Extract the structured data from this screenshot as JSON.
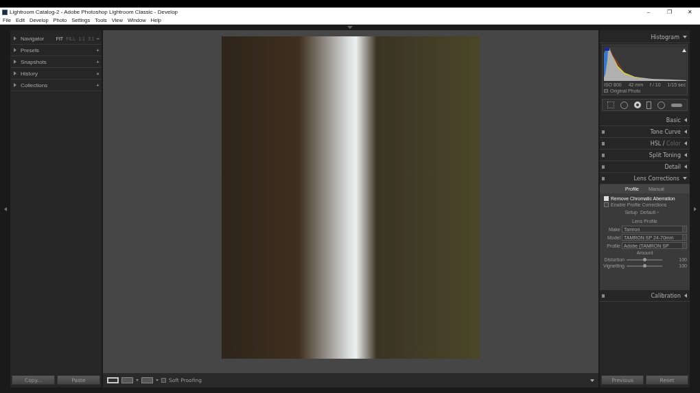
{
  "window": {
    "title": "Lightroom Catalog-2 - Adobe Photoshop Lightroom Classic - Develop",
    "controls": [
      "–",
      "❐",
      "✕"
    ]
  },
  "menu": [
    "File",
    "Edit",
    "Develop",
    "Photo",
    "Settings",
    "Tools",
    "View",
    "Window",
    "Help"
  ],
  "left_panels": [
    {
      "label": "Navigator",
      "zoom": [
        {
          "label": "FIT",
          "selected": true
        },
        {
          "label": "FILL",
          "selected": false
        },
        {
          "label": "1:1",
          "selected": false
        },
        {
          "label": "3:1",
          "selected": false
        }
      ],
      "action": "÷"
    },
    {
      "label": "Presets",
      "action": "+"
    },
    {
      "label": "Snapshots",
      "action": "+"
    },
    {
      "label": "History",
      "action": "×"
    },
    {
      "label": "Collections",
      "action": "+"
    }
  ],
  "left_buttons": [
    "Copy...",
    "Paste"
  ],
  "histogram": {
    "title": "Histogram",
    "info": [
      "ISO 800",
      "42 mm",
      "f / 10",
      "1/15 sec"
    ],
    "original_photo": {
      "label": "Original Photo",
      "checked": false
    }
  },
  "right_panels": [
    {
      "label": "Basic",
      "expanded": false,
      "switch": false
    },
    {
      "label": "Tone Curve",
      "expanded": false,
      "switch": true
    },
    {
      "label": "HSL",
      "separator": "/",
      "label_2": "Color",
      "expanded": false,
      "switch": true
    },
    {
      "label": "Split Toning",
      "expanded": false,
      "switch": true
    },
    {
      "label": "Detail",
      "expanded": false,
      "switch": true
    },
    {
      "label": "Lens Corrections",
      "expanded": true,
      "switch": true
    },
    {
      "label": "Calibration",
      "expanded": false,
      "switch": true
    }
  ],
  "lens": {
    "tabs": [
      {
        "label": "Profile",
        "selected": true
      },
      {
        "label": "Manual",
        "selected": false
      }
    ],
    "checks": [
      {
        "label": "Remove Chromatic Aberration",
        "checked": true
      },
      {
        "label": "Enable Profile Corrections",
        "checked": false
      }
    ],
    "setup": {
      "label": "Setup",
      "value": "Default ÷"
    },
    "profile_heading": "Lens Profile",
    "fields": [
      {
        "label": "Make",
        "value": "Tamron"
      },
      {
        "label": "Model",
        "value": "TAMRON SP 24-70mm"
      },
      {
        "label": "Profile",
        "value": "Adobe (TAMRON SP"
      }
    ],
    "amount_heading": "Amount",
    "sliders": [
      {
        "label": "Distortion",
        "level": 0.5,
        "reading": "100"
      },
      {
        "label": "Vignetting",
        "level": 0.5,
        "reading": "100"
      }
    ]
  },
  "toolbar": {
    "soft_proofing": {
      "label": "Soft Proofing",
      "checked": false
    }
  },
  "right_buttons": [
    "Previous",
    "Reset"
  ]
}
